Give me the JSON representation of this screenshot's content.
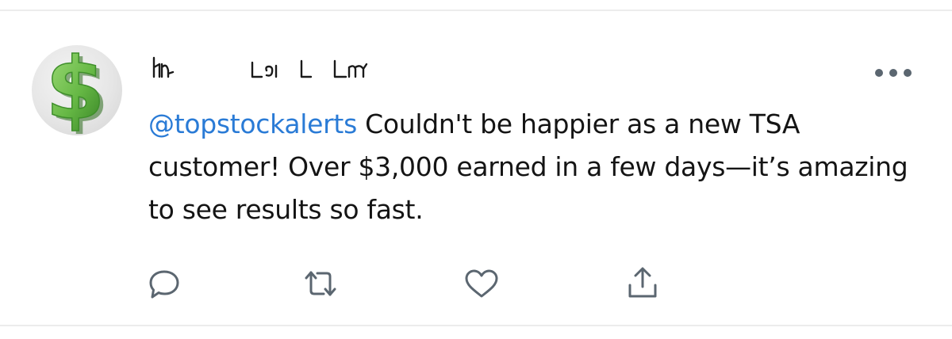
{
  "tweet": {
    "author_display_name": "Ꮒ⌐ Lᗣ∣ L Lᗰ",
    "avatar": {
      "icon": "dollar-sign-icon",
      "glyph": "$",
      "color_light": "#8ed16b",
      "color_dark": "#3f8f2b"
    },
    "mention": "@topstockalerts",
    "body_text": " Couldn't be happier as a new TSA customer! Over $3,000 earned in a few days—it’s amazing to see results so fast.",
    "more_icon": "more-horizontal-icon"
  },
  "actions": [
    {
      "name": "reply",
      "icon": "reply-icon"
    },
    {
      "name": "retweet",
      "icon": "retweet-icon"
    },
    {
      "name": "like",
      "icon": "heart-icon"
    },
    {
      "name": "share",
      "icon": "share-icon"
    }
  ],
  "colors": {
    "mention": "#2a7bd6",
    "text": "#141414",
    "icon": "#5b6670",
    "divider": "#ececec"
  }
}
